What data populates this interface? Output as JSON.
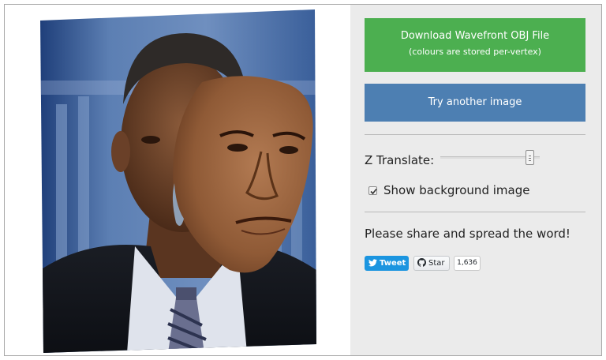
{
  "panel": {
    "download": {
      "line1": "Download Wavefront OBJ File",
      "line2": "(colours are stored per-vertex)"
    },
    "try_another": "Try another image",
    "z_translate": {
      "label": "Z Translate:",
      "value_fraction": 0.94
    },
    "show_background": {
      "label": "Show background image",
      "checked": true
    },
    "share_text": "Please share and spread the word!",
    "social": {
      "tweet": "Tweet",
      "star": "Star",
      "star_count": "1,636"
    }
  },
  "colors": {
    "download_button": "#4caf50",
    "try_another_button": "#4d7fb2",
    "panel_background": "#ebebeb",
    "tweet_button": "#1b95e0"
  },
  "icons": [
    "twitter-bird-icon",
    "github-octocat-icon",
    "checkmark-icon"
  ]
}
